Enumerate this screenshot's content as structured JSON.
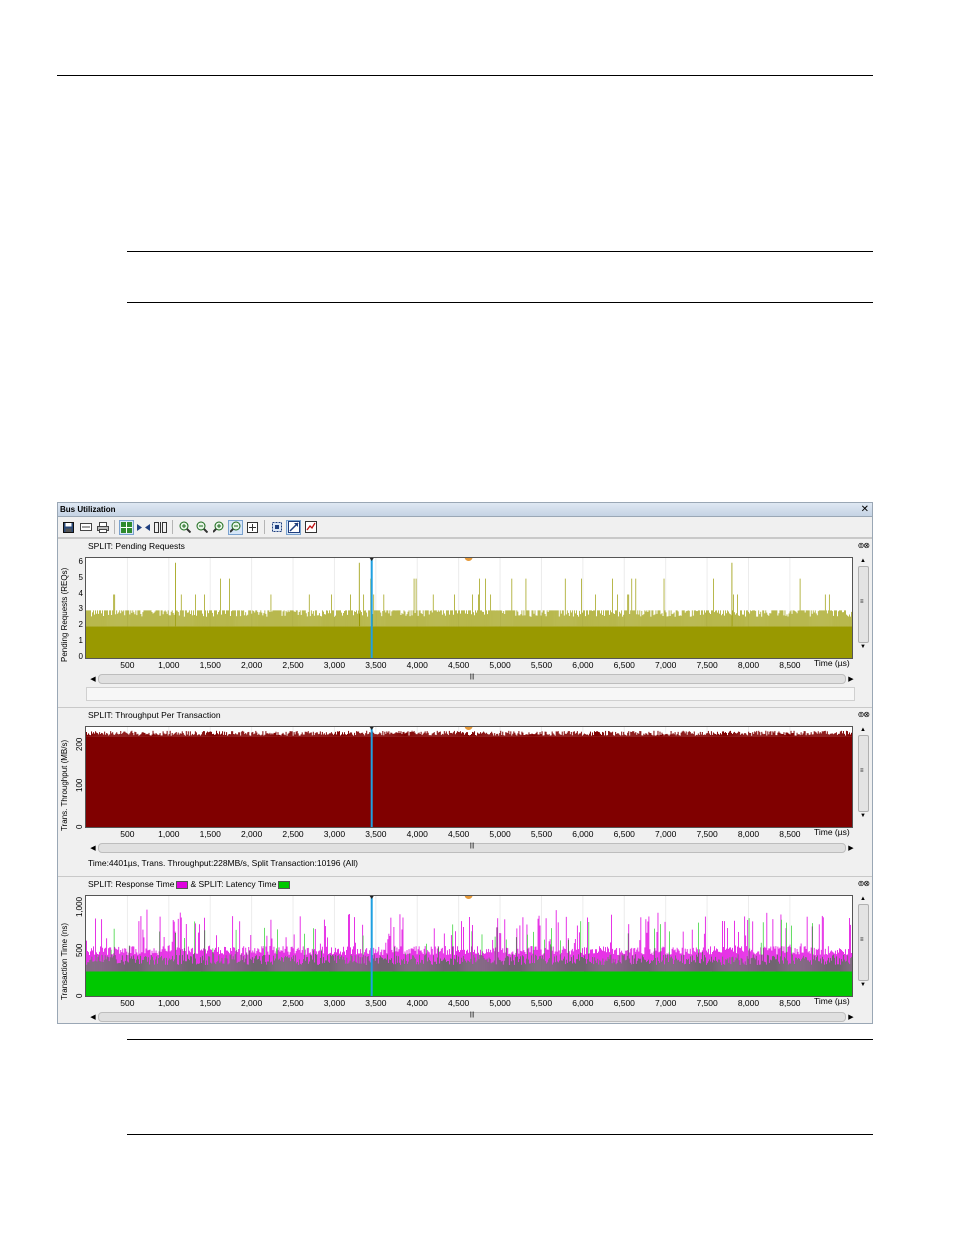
{
  "window": {
    "title": "Bus Utilization",
    "close_glyph": "✕"
  },
  "toolbar": {
    "icons": [
      "save-icon",
      "print-preview-icon",
      "print-icon",
      "grid-view-icon",
      "link-icon",
      "bracket-icon",
      "zoom-in-icon",
      "zoom-out-icon",
      "zoom-in-x-icon",
      "zoom-out-x-icon",
      "fit-icon",
      "fit-selection-icon",
      "expand-icon",
      "settings-icon"
    ]
  },
  "panels": [
    {
      "title": "SPLIT: Pending Requests",
      "ylabel": "Pending Requests (REQs)",
      "yticks": [
        "6",
        "5",
        "4",
        "3",
        "2",
        "1",
        "0"
      ],
      "xunit": "Time (µs)",
      "xticks": [
        "500",
        "1,000",
        "1,500",
        "2,000",
        "2,500",
        "3,000",
        "3,500",
        "4,000",
        "4,500",
        "5,000",
        "5,500",
        "6,000",
        "6,500",
        "7,000",
        "7,500",
        "8,000",
        "8,500"
      ],
      "status": ""
    },
    {
      "title": "SPLIT: Throughput Per Transaction",
      "ylabel": "Trans. Throughput (MB/s)",
      "yticks": [
        "200",
        "100",
        "0"
      ],
      "xunit": "Time (µs)",
      "xticks": [
        "500",
        "1,000",
        "1,500",
        "2,000",
        "2,500",
        "3,000",
        "3,500",
        "4,000",
        "4,500",
        "5,000",
        "5,500",
        "6,000",
        "6,500",
        "7,000",
        "7,500",
        "8,000",
        "8,500"
      ],
      "status": "Time:4401µs, Trans. Throughput:228MB/s, Split Transaction:10196 (All)"
    },
    {
      "title": "SPLIT: Response Time",
      "title_mid": "& SPLIT: Latency Time",
      "ylabel": "Transaction Time (ns)",
      "yticks": [
        "1,000",
        "500",
        "0"
      ],
      "xunit": "Time (µs)",
      "xticks": [
        "500",
        "1,000",
        "1,500",
        "2,000",
        "2,500",
        "3,000",
        "3,500",
        "4,000",
        "4,500",
        "5,000",
        "5,500",
        "6,000",
        "6,500",
        "7,000",
        "7,500",
        "8,000",
        "8,500"
      ],
      "status": ""
    }
  ],
  "chart_data": [
    {
      "type": "bar",
      "title": "SPLIT: Pending Requests",
      "xlabel": "Time (µs)",
      "ylabel": "Pending Requests (REQs)",
      "xlim": [
        0,
        9250
      ],
      "ylim": [
        0,
        6.3
      ],
      "cursor_x": 3450,
      "marker_x": 4620,
      "baseline": 2,
      "typical_max": 3,
      "colors": {
        "bar": "#999900"
      }
    },
    {
      "type": "bar",
      "title": "SPLIT: Throughput Per Transaction",
      "xlabel": "Time (µs)",
      "ylabel": "Trans. Throughput (MB/s)",
      "xlim": [
        0,
        9250
      ],
      "ylim": [
        0,
        240
      ],
      "cursor_x": 3450,
      "marker_x": 4620,
      "typical": 225,
      "colors": {
        "bar": "#800000"
      }
    },
    {
      "type": "bar",
      "title": "SPLIT: Response Time & SPLIT: Latency Time",
      "xlabel": "Time (µs)",
      "ylabel": "Transaction Time (ns)",
      "xlim": [
        0,
        9250
      ],
      "ylim": [
        0,
        1100
      ],
      "cursor_x": 3450,
      "marker_x": 4620,
      "series": [
        {
          "name": "SPLIT: Response Time",
          "typical": 500,
          "color": "#e000e0"
        },
        {
          "name": "SPLIT: Latency Time",
          "typical": 400,
          "color": "#00c800"
        }
      ]
    }
  ]
}
